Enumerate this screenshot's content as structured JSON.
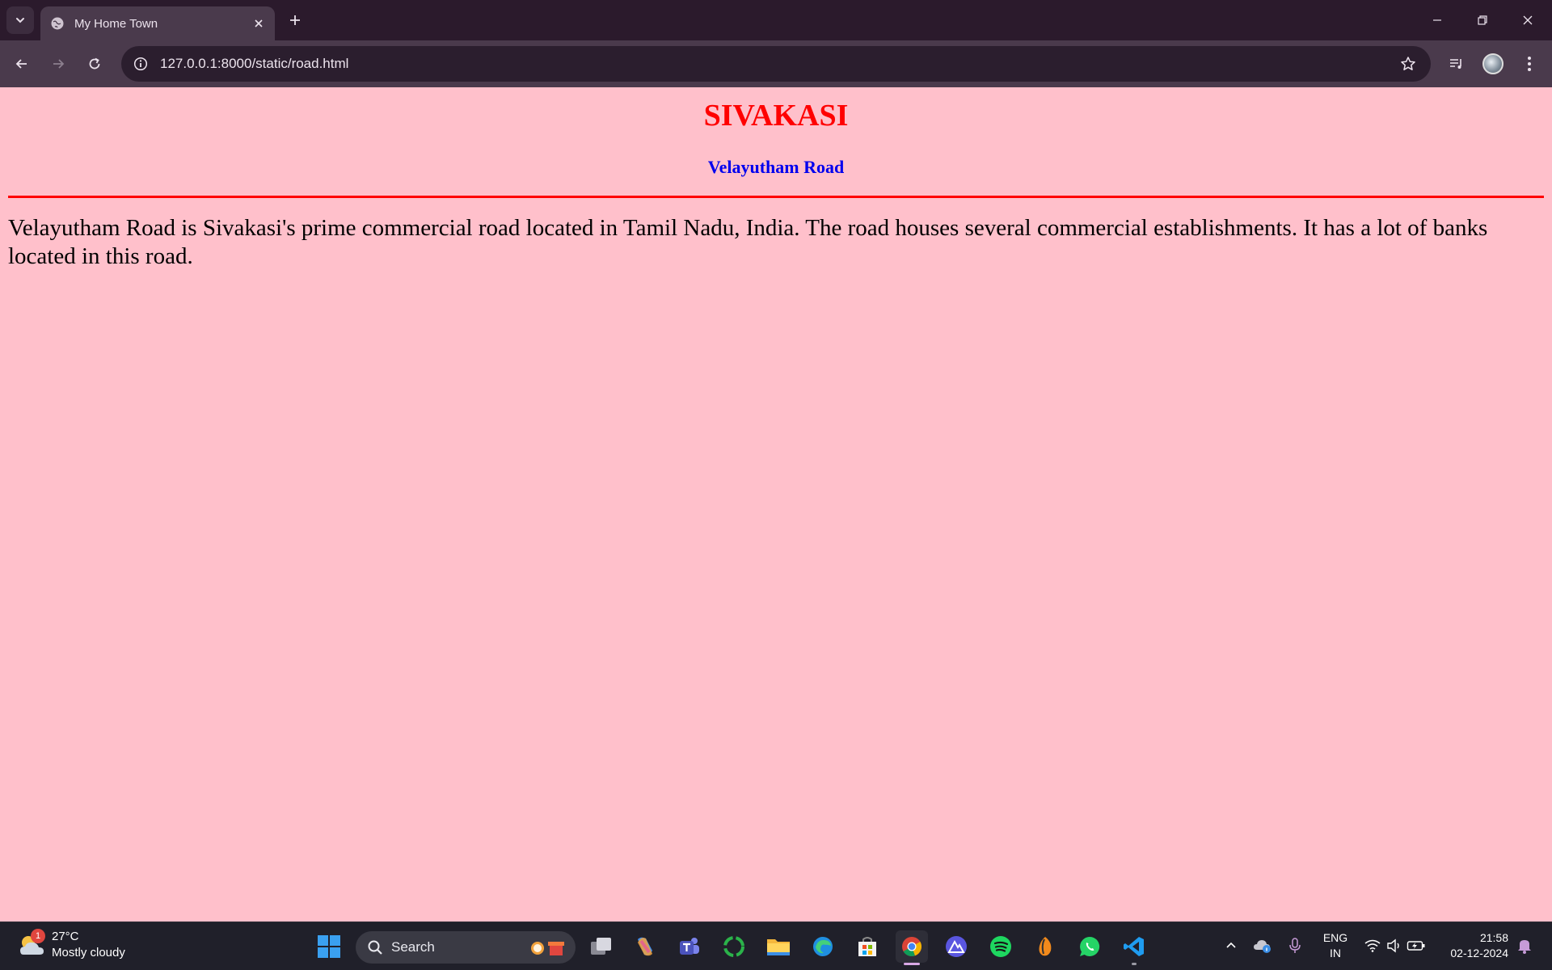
{
  "browser": {
    "tab_title": "My Home Town",
    "url": "127.0.0.1:8000/static/road.html"
  },
  "page": {
    "heading": "SIVAKASI",
    "subheading": "Velayutham Road",
    "paragraph": "Velayutham Road is Sivakasi's prime commercial road located in Tamil Nadu, India. The road houses several commercial establishments. It has a lot of banks located in this road.",
    "background_color": "#ffc0cb",
    "heading_color": "#ff0000",
    "subheading_color": "#0000ee"
  },
  "taskbar": {
    "weather": {
      "temperature": "27°C",
      "condition": "Mostly cloudy",
      "badge": "1"
    },
    "search_label": "Search",
    "pinned_apps": [
      "start-icon",
      "task-view-icon",
      "copilot-icon",
      "teams-icon",
      "circle-app-icon",
      "file-explorer-icon",
      "edge-icon",
      "store-icon",
      "chrome-icon",
      "mountain-app-icon",
      "spotify-icon",
      "fl-studio-icon",
      "whatsapp-icon",
      "vscode-icon"
    ],
    "language": {
      "line1": "ENG",
      "line2": "IN"
    },
    "clock": {
      "time": "21:58",
      "date": "02-12-2024"
    }
  }
}
